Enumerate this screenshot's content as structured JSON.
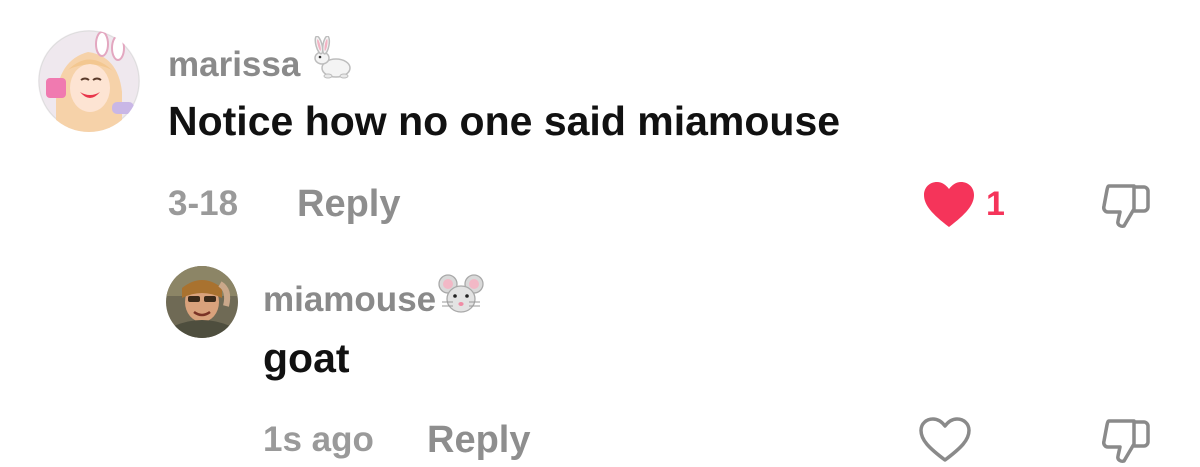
{
  "comments": [
    {
      "username": "marissa",
      "username_emoji": "rabbit-emoji",
      "text": "Notice how no one said miamouse",
      "time": "3-18",
      "reply_label": "Reply",
      "like_count": "1",
      "liked": true,
      "avatar": "anime-girl-avatar"
    }
  ],
  "reply": {
    "username": "miamouse",
    "username_emoji": "mouse-emoji",
    "text": "goat",
    "time": "1s ago",
    "reply_label": "Reply",
    "liked": false,
    "avatar": "user-photo-avatar"
  },
  "colors": {
    "like_active": "#f5345a",
    "meta_gray": "#9a9a9a",
    "text": "#111111"
  }
}
